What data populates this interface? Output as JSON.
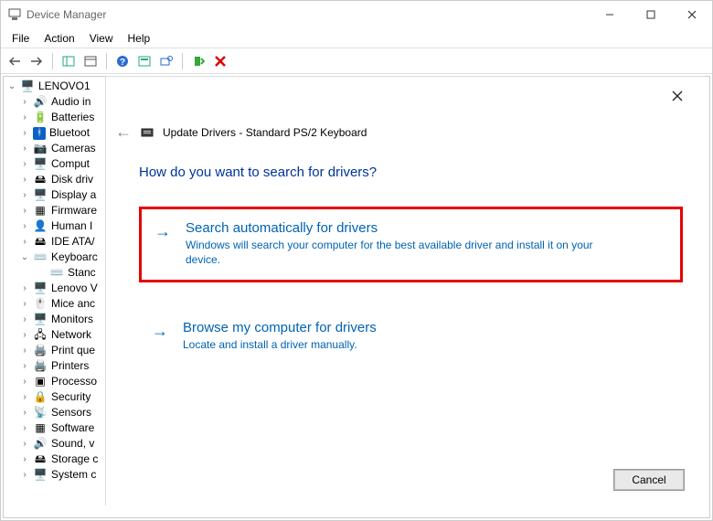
{
  "window": {
    "title": "Device Manager"
  },
  "menus": [
    "File",
    "Action",
    "View",
    "Help"
  ],
  "tree": {
    "root": "LENOVO1",
    "items": [
      {
        "label": "Audio in",
        "icon": "🔊"
      },
      {
        "label": "Batteries",
        "icon": "🔋"
      },
      {
        "label": "Bluetoot",
        "icon": "ᚼ",
        "bt": true
      },
      {
        "label": "Cameras",
        "icon": "📷"
      },
      {
        "label": "Comput",
        "icon": "🖥️"
      },
      {
        "label": "Disk driv",
        "icon": "🖴"
      },
      {
        "label": "Display a",
        "icon": "🖥️"
      },
      {
        "label": "Firmware",
        "icon": "▦"
      },
      {
        "label": "Human I",
        "icon": "👤"
      },
      {
        "label": "IDE ATA/",
        "icon": "🖴"
      },
      {
        "label": "Keyboarc",
        "icon": "⌨️",
        "expanded": true,
        "children": [
          {
            "label": "Stanc",
            "icon": "⌨️"
          }
        ]
      },
      {
        "label": "Lenovo V",
        "icon": "🖥️"
      },
      {
        "label": "Mice anc",
        "icon": "🖱️"
      },
      {
        "label": "Monitors",
        "icon": "🖥️"
      },
      {
        "label": "Network",
        "icon": "🖧"
      },
      {
        "label": "Print que",
        "icon": "🖨️"
      },
      {
        "label": "Printers",
        "icon": "🖨️"
      },
      {
        "label": "Processo",
        "icon": "▣"
      },
      {
        "label": "Security",
        "icon": "🔒"
      },
      {
        "label": "Sensors",
        "icon": "📡"
      },
      {
        "label": "Software",
        "icon": "▦"
      },
      {
        "label": "Sound, v",
        "icon": "🔊"
      },
      {
        "label": "Storage c",
        "icon": "🖴"
      },
      {
        "label": "System c",
        "icon": "🖥️"
      }
    ]
  },
  "dialog": {
    "title": "Update Drivers - Standard PS/2 Keyboard",
    "question": "How do you want to search for drivers?",
    "option1_title": "Search automatically for drivers",
    "option1_desc": "Windows will search your computer for the best available driver and install it on your device.",
    "option2_title": "Browse my computer for drivers",
    "option2_desc": "Locate and install a driver manually.",
    "cancel": "Cancel"
  }
}
